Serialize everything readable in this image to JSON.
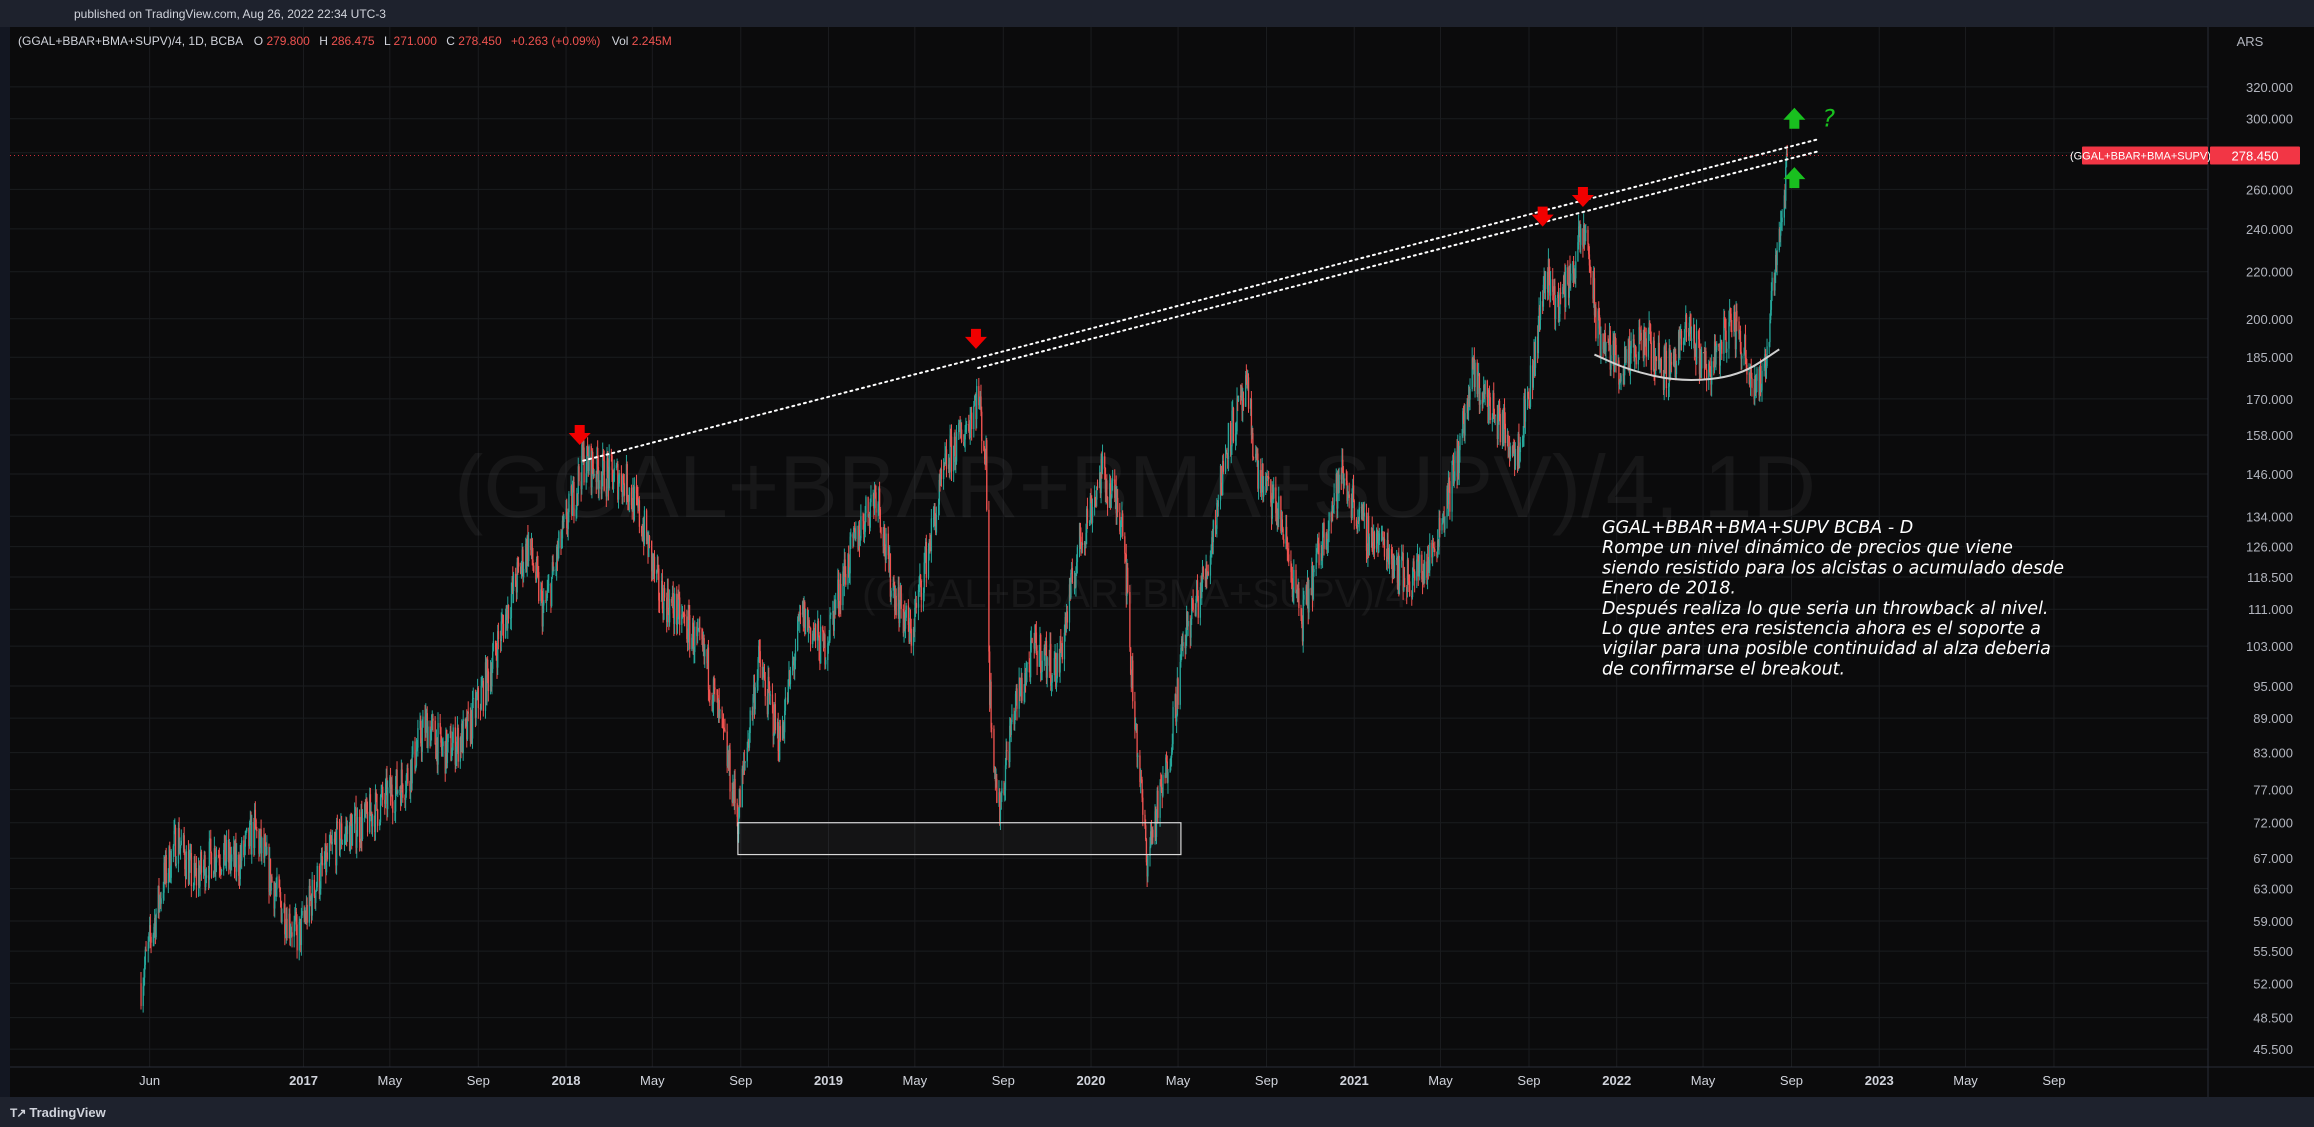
{
  "header": {
    "published": "published on TradingView.com, Aug 26, 2022 22:34 UTC-3"
  },
  "footer": {
    "logo_text": "TradingView",
    "logo_mark": "T↗"
  },
  "legend": {
    "symbol": "(GGAL+BBAR+BMA+SUPV)/4, 1D, BCBA",
    "o_label": "O",
    "o_value": "279.800",
    "h_label": "H",
    "h_value": "286.475",
    "l_label": "L",
    "l_value": "271.000",
    "c_label": "C",
    "c_value": "278.450",
    "change": "+0.263 (+0.09%)",
    "vol_label": "Vol",
    "vol_value": "2.245M"
  },
  "watermark": {
    "main": "(GGAL+BBAR+BMA+SUPV)/4, 1D",
    "sub": "(GGAL+BBAR+BMA+SUPV)/4"
  },
  "price_axis": {
    "currency": "ARS",
    "ticks": [
      320,
      300,
      280,
      260,
      240,
      220,
      200,
      185,
      170,
      158,
      146,
      134,
      126,
      118.5,
      111,
      103,
      95,
      89,
      83,
      77,
      72,
      67,
      63,
      59,
      55.5,
      52,
      48.5,
      45.5
    ],
    "tick_labels": [
      "320.000",
      "300.000",
      "",
      "260.000",
      "240.000",
      "220.000",
      "200.000",
      "185.000",
      "170.000",
      "158.000",
      "146.000",
      "134.000",
      "126.000",
      "118.500",
      "111.000",
      "103.000",
      "95.000",
      "89.000",
      "83.000",
      "77.000",
      "72.000",
      "67.000",
      "63.000",
      "59.000",
      "55.500",
      "52.000",
      "48.500",
      "45.500"
    ],
    "last_price_label": "278.450",
    "last_price_symbol": "(GGAL+BBAR+BMA+SUPV)/4"
  },
  "annotation": {
    "lines": [
      "GGAL+BBAR+BMA+SUPV BCBA - D",
      "Rompe un nivel dinámico de precios que viene",
      "siendo resistido para los alcistas o acumulado desde",
      "Enero de 2018.",
      "Después realiza lo que seria un throwback al nivel.",
      "Lo que antes era resistencia ahora es el soporte a",
      "vigilar para una posible continuidad al alza deberia",
      "de confirmarse el breakout."
    ],
    "question_mark": "?"
  },
  "colors": {
    "background": "#0b0b0c",
    "up": "#26a69a",
    "down": "#ef5350",
    "red_arrow": "#f20000",
    "green_arrow": "#19c01f",
    "price_label_bg": "#f23645"
  },
  "chart_data": {
    "type": "candlestick",
    "title": "(GGAL+BBAR+BMA+SUPV)/4, 1D, BCBA",
    "y_scale": "log",
    "ylim": [
      43,
      340
    ],
    "x_range": [
      "2016-05-20",
      "2023-12-31"
    ],
    "x_tick_labels": [
      {
        "date": "2016-06-01",
        "label": "Jun"
      },
      {
        "date": "2017-01-01",
        "label": "2017"
      },
      {
        "date": "2017-05-01",
        "label": "May"
      },
      {
        "date": "2017-09-01",
        "label": "Sep"
      },
      {
        "date": "2018-01-01",
        "label": "2018"
      },
      {
        "date": "2018-05-01",
        "label": "May"
      },
      {
        "date": "2018-09-01",
        "label": "Sep"
      },
      {
        "date": "2019-01-01",
        "label": "2019"
      },
      {
        "date": "2019-05-01",
        "label": "May"
      },
      {
        "date": "2019-09-01",
        "label": "Sep"
      },
      {
        "date": "2020-01-01",
        "label": "2020"
      },
      {
        "date": "2020-05-01",
        "label": "May"
      },
      {
        "date": "2020-09-01",
        "label": "Sep"
      },
      {
        "date": "2021-01-01",
        "label": "2021"
      },
      {
        "date": "2021-05-01",
        "label": "May"
      },
      {
        "date": "2021-09-01",
        "label": "Sep"
      },
      {
        "date": "2022-01-01",
        "label": "2022"
      },
      {
        "date": "2022-05-01",
        "label": "May"
      },
      {
        "date": "2022-09-01",
        "label": "Sep"
      },
      {
        "date": "2023-01-01",
        "label": "2023"
      },
      {
        "date": "2023-05-01",
        "label": "May"
      },
      {
        "date": "2023-09-01",
        "label": "Sep"
      }
    ],
    "price_path": [
      [
        "2016-05-20",
        52
      ],
      [
        "2016-06-20",
        64
      ],
      [
        "2016-07-10",
        70
      ],
      [
        "2016-08-01",
        64
      ],
      [
        "2016-09-01",
        68
      ],
      [
        "2016-10-01",
        66
      ],
      [
        "2016-10-25",
        71
      ],
      [
        "2016-11-25",
        62
      ],
      [
        "2016-12-25",
        57
      ],
      [
        "2017-01-20",
        64
      ],
      [
        "2017-02-20",
        70
      ],
      [
        "2017-03-25",
        72
      ],
      [
        "2017-04-20",
        75
      ],
      [
        "2017-05-25",
        79
      ],
      [
        "2017-06-20",
        88
      ],
      [
        "2017-07-15",
        83
      ],
      [
        "2017-08-15",
        86
      ],
      [
        "2017-09-15",
        97
      ],
      [
        "2017-10-15",
        113
      ],
      [
        "2017-11-10",
        127
      ],
      [
        "2017-12-01",
        110
      ],
      [
        "2017-12-25",
        127
      ],
      [
        "2018-01-25",
        150
      ],
      [
        "2018-02-25",
        146
      ],
      [
        "2018-03-25",
        144
      ],
      [
        "2018-04-20",
        130
      ],
      [
        "2018-05-10",
        115
      ],
      [
        "2018-06-15",
        108
      ],
      [
        "2018-07-15",
        100
      ],
      [
        "2018-08-10",
        84
      ],
      [
        "2018-08-28",
        73
      ],
      [
        "2018-09-25",
        100
      ],
      [
        "2018-10-25",
        85
      ],
      [
        "2018-11-25",
        110
      ],
      [
        "2018-12-25",
        102
      ],
      [
        "2019-01-20",
        118
      ],
      [
        "2019-02-20",
        134
      ],
      [
        "2019-03-10",
        142
      ],
      [
        "2019-03-25",
        120
      ],
      [
        "2019-04-25",
        105
      ],
      [
        "2019-05-20",
        126
      ],
      [
        "2019-06-15",
        150
      ],
      [
        "2019-07-10",
        160
      ],
      [
        "2019-07-28",
        172
      ],
      [
        "2019-08-08",
        150
      ],
      [
        "2019-08-13",
        95
      ],
      [
        "2019-08-25",
        73
      ],
      [
        "2019-09-15",
        90
      ],
      [
        "2019-10-15",
        103
      ],
      [
        "2019-11-15",
        98
      ],
      [
        "2019-12-15",
        126
      ],
      [
        "2020-01-15",
        146
      ],
      [
        "2020-02-15",
        134
      ],
      [
        "2020-02-25",
        100
      ],
      [
        "2020-03-18",
        67
      ],
      [
        "2020-04-15",
        80
      ],
      [
        "2020-05-10",
        105
      ],
      [
        "2020-06-10",
        120
      ],
      [
        "2020-07-10",
        158
      ],
      [
        "2020-08-05",
        172
      ],
      [
        "2020-08-20",
        146
      ],
      [
        "2020-09-20",
        134
      ],
      [
        "2020-10-20",
        108
      ],
      [
        "2020-11-15",
        126
      ],
      [
        "2020-12-15",
        146
      ],
      [
        "2021-01-15",
        130
      ],
      [
        "2021-02-15",
        126
      ],
      [
        "2021-03-15",
        118
      ],
      [
        "2021-04-15",
        122
      ],
      [
        "2021-05-20",
        146
      ],
      [
        "2021-06-15",
        178
      ],
      [
        "2021-07-15",
        165
      ],
      [
        "2021-08-15",
        153
      ],
      [
        "2021-09-05",
        178
      ],
      [
        "2021-09-25",
        222
      ],
      [
        "2021-10-10",
        205
      ],
      [
        "2021-10-25",
        215
      ],
      [
        "2021-11-10",
        232
      ],
      [
        "2021-11-20",
        238
      ],
      [
        "2021-12-05",
        195
      ],
      [
        "2022-01-10",
        180
      ],
      [
        "2022-02-10",
        192
      ],
      [
        "2022-03-10",
        180
      ],
      [
        "2022-04-10",
        195
      ],
      [
        "2022-05-10",
        180
      ],
      [
        "2022-06-10",
        200
      ],
      [
        "2022-07-10",
        178
      ],
      [
        "2022-07-25",
        175
      ],
      [
        "2022-08-05",
        215
      ],
      [
        "2022-08-20",
        250
      ],
      [
        "2022-08-26",
        278.45
      ]
    ],
    "last_close": 278.45,
    "resistance_line_upper": {
      "from": [
        "2018-01-25",
        150
      ],
      "to": [
        "2022-10-10",
        288
      ]
    },
    "resistance_line_lower": {
      "from": [
        "2019-07-28",
        181
      ],
      "to": [
        "2022-10-10",
        281
      ]
    },
    "support_box": {
      "from": [
        "2018-08-28",
        72
      ],
      "to": [
        "2020-05-05",
        67.5
      ]
    },
    "rounding_curve": [
      [
        "2021-12-01",
        186
      ],
      [
        "2022-01-20",
        180
      ],
      [
        "2022-04-01",
        176
      ],
      [
        "2022-06-20",
        178
      ],
      [
        "2022-08-15",
        188
      ]
    ],
    "down_arrows": [
      [
        "2018-01-20",
        158
      ],
      [
        "2019-07-25",
        192
      ],
      [
        "2021-09-20",
        246
      ],
      [
        "2021-11-15",
        256
      ]
    ],
    "up_arrows": [
      [
        "2022-09-05",
        300
      ],
      [
        "2022-09-05",
        266
      ]
    ]
  }
}
